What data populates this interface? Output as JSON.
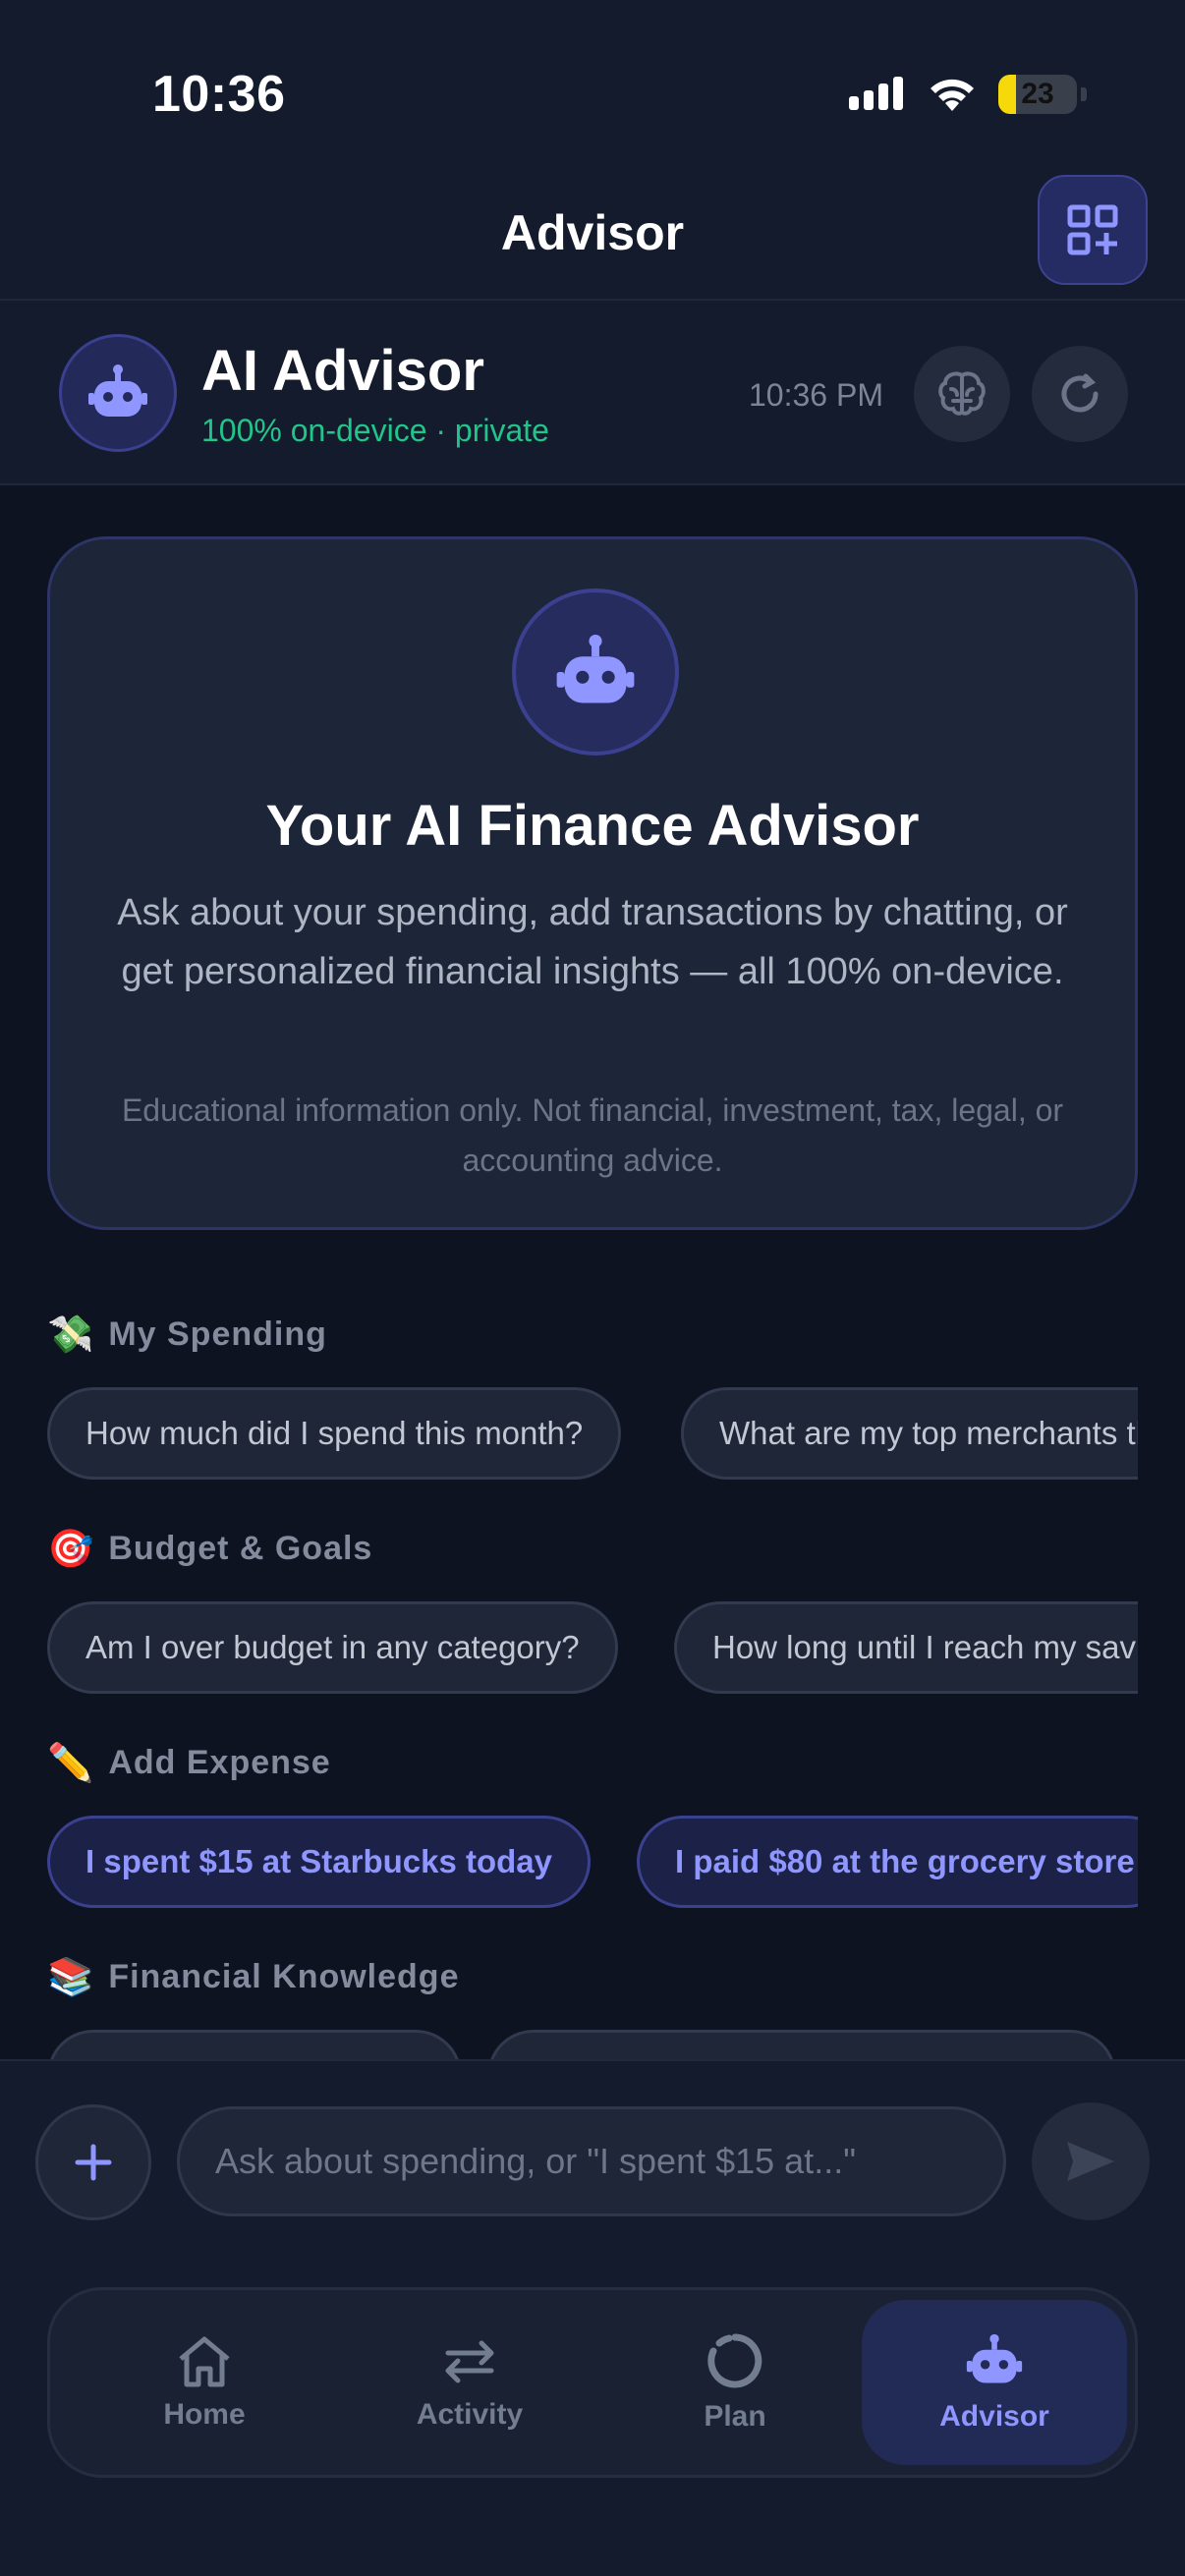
{
  "status_bar": {
    "time": "10:36",
    "battery": "23",
    "battery_level": 0.23
  },
  "nav": {
    "title": "Advisor",
    "action_icon": "grid-plus-icon"
  },
  "advisor": {
    "name": "AI Advisor",
    "subtitle": "100% on-device · private",
    "time": "10:36 PM",
    "brain_icon": "brain-icon",
    "refresh_icon": "refresh-icon"
  },
  "welcome": {
    "title": "Your AI Finance Advisor",
    "body": "Ask about your spending, add transactions by chatting, or get personalized financial insights — all 100% on-device.",
    "disclaimer": "Educational information only. Not financial, investment, tax, legal, or accounting advice."
  },
  "sections": [
    {
      "emoji": "💸",
      "label": "My Spending",
      "chips": [
        "How much did I spend this month?",
        "What are my top merchants this month?"
      ]
    },
    {
      "emoji": "🎯",
      "label": "Budget & Goals",
      "chips": [
        "Am I over budget in any category?",
        "How long until I reach my savings goal?"
      ]
    },
    {
      "emoji": "✏️",
      "label": "Add Expense",
      "chips": [
        "I spent $15 at Starbucks today",
        "I paid $80 at the grocery store"
      ]
    },
    {
      "emoji": "📚",
      "label": "Financial Knowledge",
      "chips": [
        "",
        ""
      ]
    }
  ],
  "composer": {
    "placeholder": "Ask about spending, or \"I spent $15 at...\""
  },
  "tabs": [
    {
      "label": "Home",
      "icon": "home-icon"
    },
    {
      "label": "Activity",
      "icon": "arrows-swap-icon"
    },
    {
      "label": "Plan",
      "icon": "ring-chart-icon"
    },
    {
      "label": "Advisor",
      "icon": "robot-icon",
      "active": true
    }
  ],
  "colors": {
    "accent": "#8f96ff",
    "positive": "#22c48a",
    "background": "#0d1320"
  }
}
